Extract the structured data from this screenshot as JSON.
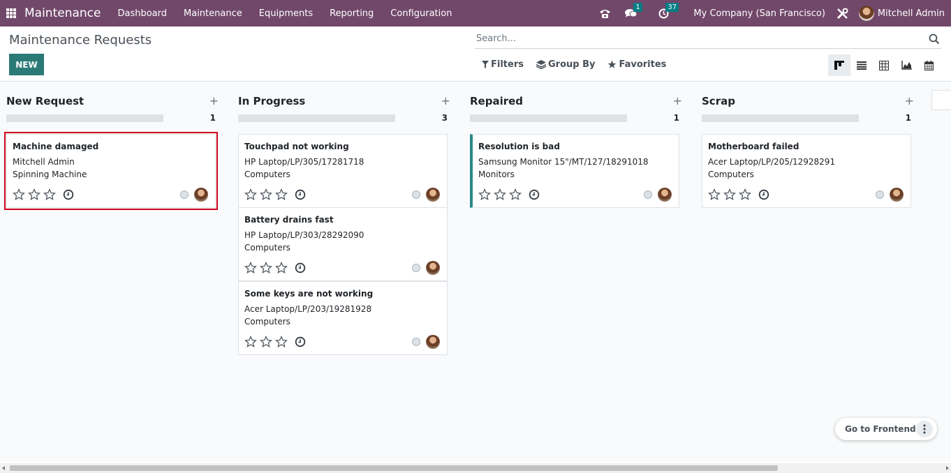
{
  "navbar": {
    "app_name": "Maintenance",
    "menu": [
      "Dashboard",
      "Maintenance",
      "Equipments",
      "Reporting",
      "Configuration"
    ],
    "messages_count": "1",
    "activities_count": "37",
    "company": "My Company (San Francisco)",
    "user": "Mitchell Admin",
    "bg_color": "#71486a"
  },
  "page": {
    "title": "Maintenance Requests",
    "new_label": "NEW"
  },
  "search": {
    "placeholder": "Search..."
  },
  "filters": {
    "filters_label": "Filters",
    "groupby_label": "Group By",
    "favorites_label": "Favorites"
  },
  "views": [
    "kanban-icon",
    "list-icon",
    "pivot-icon",
    "graph-icon",
    "calendar-icon"
  ],
  "columns": [
    {
      "title": "New Request",
      "count": "1",
      "cards": [
        {
          "title": "Machine damaged",
          "line1": "Mitchell Admin",
          "line2": "Spinning Machine"
        }
      ]
    },
    {
      "title": "In Progress",
      "count": "3",
      "cards": [
        {
          "title": "Touchpad not working",
          "line1": "HP Laptop/LP/305/17281718",
          "line2": "Computers"
        },
        {
          "title": "Battery drains fast",
          "line1": "HP Laptop/LP/303/28292090",
          "line2": "Computers"
        },
        {
          "title": "Some keys are not working",
          "line1": "Acer Laptop/LP/203/19281928",
          "line2": "Computers"
        }
      ]
    },
    {
      "title": "Repaired",
      "count": "1",
      "cards": [
        {
          "title": "Resolution is bad",
          "line1": "Samsung Monitor 15\"/MT/127/18291018",
          "line2": "Monitors"
        }
      ]
    },
    {
      "title": "Scrap",
      "count": "1",
      "cards": [
        {
          "title": "Motherboard failed",
          "line1": "Acer Laptop/LP/205/12928291",
          "line2": "Computers"
        }
      ]
    }
  ],
  "frontend": {
    "label": "Go to Frontend"
  },
  "colors": {
    "accent": "#2b7a78",
    "highlight": "#d0021b"
  }
}
